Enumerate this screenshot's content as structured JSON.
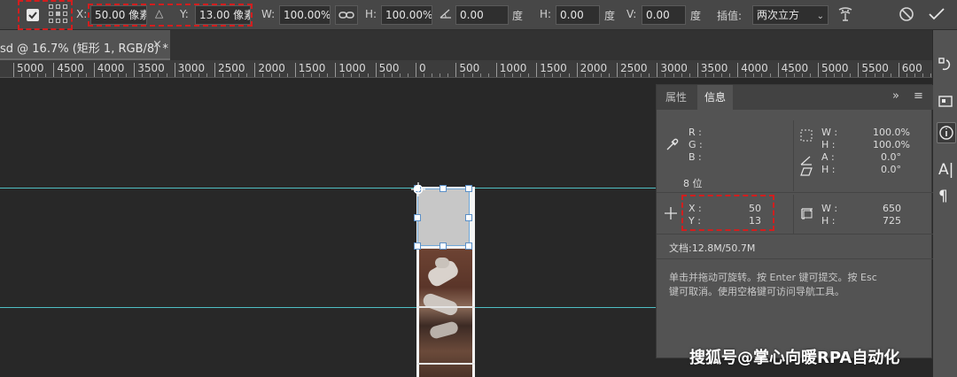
{
  "options_bar": {
    "x_label": "X:",
    "x_value": "50.00 像素",
    "delta_symbol": "△",
    "y_label": "Y:",
    "y_value": "13.00 像素",
    "w_label": "W:",
    "w_value": "100.00%",
    "h_label": "H:",
    "h_value": "100.00%",
    "angle_value": "0.00",
    "angle_unit": "度",
    "skew_h_label": "H:",
    "skew_h_value": "0.00",
    "skew_h_unit": "度",
    "skew_v_label": "V:",
    "skew_v_value": "0.00",
    "skew_v_unit": "度",
    "interp_label": "插值:",
    "interp_value": "两次立方",
    "highlight_color": "#d21e1e"
  },
  "document_tab": {
    "title": "sd @ 16.7% (矩形 1, RGB/8) *",
    "close": "×"
  },
  "ruler": {
    "labels": [
      "5000",
      "4500",
      "4000",
      "3500",
      "3000",
      "2500",
      "2000",
      "1500",
      "1000",
      "500",
      "0",
      "500",
      "1000",
      "1500",
      "2000",
      "2500",
      "3000",
      "3500",
      "4000",
      "4500",
      "5000",
      "5500",
      "600"
    ]
  },
  "info_panel": {
    "tab_properties": "属性",
    "tab_info": "信息",
    "expand": "»",
    "menu": "≡",
    "r_label": "R :",
    "g_label": "G :",
    "b_label": "B :",
    "bit_depth": "8 位",
    "w_label": "W :",
    "w_value": "100.0%",
    "h_label": "H :",
    "h_value": "100.0%",
    "a_label": "A :",
    "a_value": "0.0°",
    "h2_label": "H :",
    "h2_value": "0.0°",
    "x_label": "X :",
    "x_value": "50",
    "y_label": "Y :",
    "y_value": "13",
    "size_w_label": "W :",
    "size_w_value": "650",
    "size_h_label": "H :",
    "size_h_value": "725",
    "doc_info": "文档:12.8M/50.7M",
    "hint_line1": "单击并拖动可旋转。按 Enter 键可提交。按 Esc",
    "hint_line2": "键可取消。使用空格键可访问导航工具。"
  },
  "watermark": "搜狐号@掌心向暖RPA自动化",
  "colors": {
    "guide": "#4fbfc4",
    "panel_bg": "#535353",
    "optbar_bg": "#474747"
  }
}
